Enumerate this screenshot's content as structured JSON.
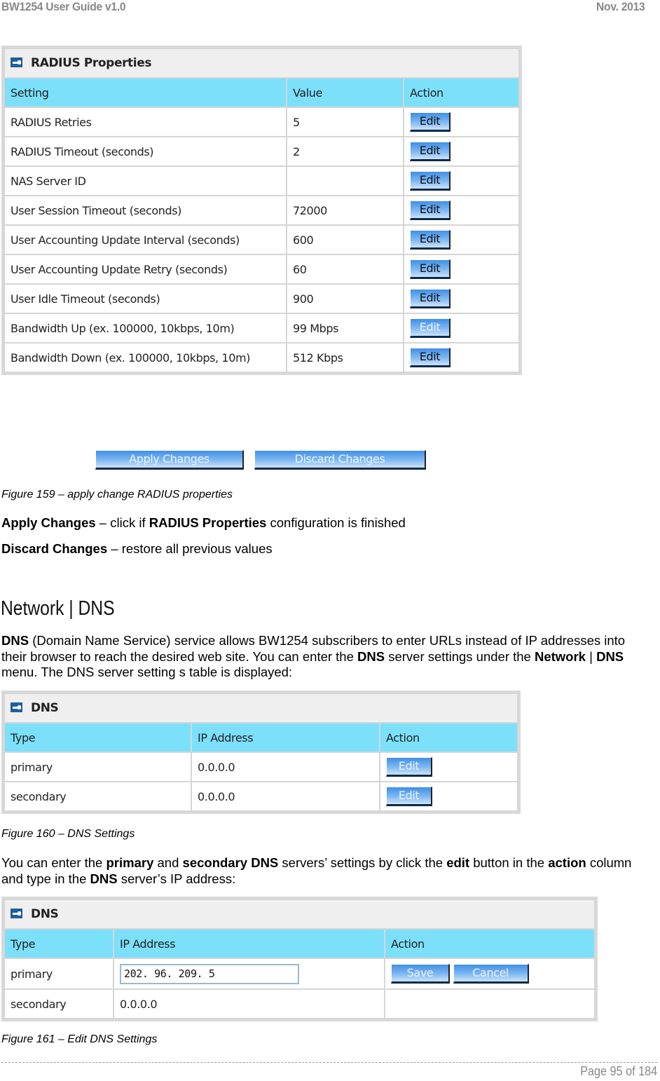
{
  "header": {
    "doc_title": "BW1254 User Guide v1.0",
    "date": "Nov.  2013"
  },
  "radius_panel": {
    "title": "RADIUS Properties",
    "columns": [
      "Setting",
      "Value",
      "Action"
    ],
    "rows": [
      {
        "setting": "RADIUS Retries",
        "value": "5",
        "action": "Edit"
      },
      {
        "setting": "RADIUS Timeout (seconds)",
        "value": "2",
        "action": "Edit"
      },
      {
        "setting": "NAS Server ID",
        "value": "",
        "action": "Edit"
      },
      {
        "setting": "User Session Timeout (seconds)",
        "value": "72000",
        "action": "Edit"
      },
      {
        "setting": "User Accounting Update Interval (seconds)",
        "value": "600",
        "action": "Edit"
      },
      {
        "setting": "User Accounting Update Retry (seconds)",
        "value": "60",
        "action": "Edit"
      },
      {
        "setting": "User Idle Timeout (seconds)",
        "value": "900",
        "action": "Edit"
      },
      {
        "setting": "Bandwidth Up (ex. 100000, 10kbps, 10m)",
        "value": "99 Mbps",
        "action": "Edit"
      },
      {
        "setting": "Bandwidth Down (ex. 100000, 10kbps, 10m)",
        "value": "512 Kbps",
        "action": "Edit"
      }
    ]
  },
  "buttons": {
    "apply": "Apply Changes",
    "discard": "Discard Changes"
  },
  "figure159": "Figure 159 – apply change RADIUS properties",
  "desc": {
    "apply_term": "Apply Changes",
    "apply_text_1": " – click if ",
    "apply_bold": "RADIUS Properties",
    "apply_text_2": " configuration is finished",
    "discard_term": "Discard Changes",
    "discard_text": " – restore all previous values"
  },
  "section_heading": "Network | DNS",
  "dns_intro": {
    "b1": "DNS",
    "t1": " (Domain Name Service) service allows BW1254 subscribers to enter URLs instead of IP addresses into their browser to reach the desired web site. You can enter the ",
    "b2": "DNS",
    "t2": " server settings under the ",
    "b3": "Network",
    "t3": " | ",
    "b4": "DNS",
    "t4": " menu. The DNS server setting s table is displayed:"
  },
  "dns_panel": {
    "title": "DNS",
    "columns": [
      "Type",
      "IP Address",
      "Action"
    ],
    "rows": [
      {
        "type": "primary",
        "ip": "0.0.0.0",
        "action": "Edit"
      },
      {
        "type": "secondary",
        "ip": "0.0.0.0",
        "action": "Edit"
      }
    ]
  },
  "figure160": "Figure 160 – DNS Settings",
  "edit_intro": {
    "t1": "You can enter the ",
    "b1": "primary",
    "t2": " and ",
    "b2": "secondary DNS",
    "t3": " servers’ settings by click the ",
    "b3": "edit",
    "t4": " button in the ",
    "b4": "action",
    "t5": " column and type in the ",
    "b5": "DNS",
    "t6": " server’s IP address:"
  },
  "dns_edit_panel": {
    "title": "DNS",
    "columns": [
      "Type",
      "IP Address",
      "Action"
    ],
    "primary": {
      "type": "primary",
      "ip_input_value": "202. 96. 209. 5",
      "save": "Save",
      "cancel": "Cancel"
    },
    "secondary": {
      "type": "secondary",
      "ip": "0.0.0.0"
    }
  },
  "figure161": "Figure 161 – Edit DNS Settings",
  "footer": {
    "page": "Page 95 of 184"
  },
  "colors": {
    "table_header_bg": "#7ce0fb",
    "panel_title_bg": "#efefef",
    "button_blue": "#3f8fe6",
    "icon_blue": "#1e5f9c",
    "header_gray": "#888888"
  }
}
